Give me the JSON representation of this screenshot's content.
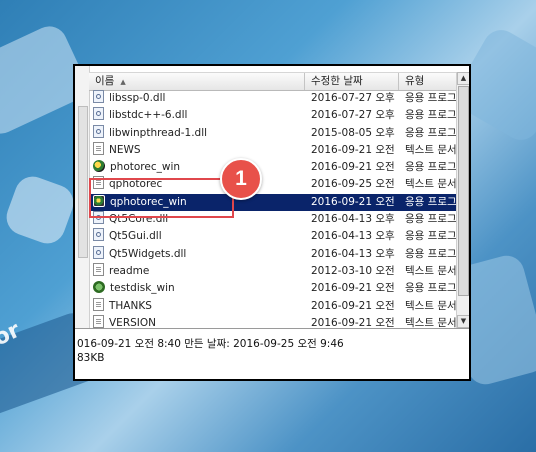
{
  "columns": [
    {
      "label": "이름",
      "sort_icon": "sort-up-icon",
      "sort_glyph": "▲"
    },
    {
      "label": "수정한 날짜"
    },
    {
      "label": "유형"
    }
  ],
  "files": [
    {
      "name": "libssp-0.dll",
      "date": "2016-07-27 오후 ...",
      "type": "응용 프로그",
      "icon": "dll-icon"
    },
    {
      "name": "libstdc++-6.dll",
      "date": "2016-07-27 오후 ...",
      "type": "응용 프로그",
      "icon": "dll-icon"
    },
    {
      "name": "libwinpthread-1.dll",
      "date": "2015-08-05 오후 ...",
      "type": "응용 프로그",
      "icon": "dll-icon"
    },
    {
      "name": "NEWS",
      "date": "2016-09-21 오전 ...",
      "type": "텍스트 문서",
      "icon": "document-icon"
    },
    {
      "name": "photorec_win",
      "date": "2016-09-21 오전 ...",
      "type": "응용 프로그",
      "icon": "photorec-app-icon"
    },
    {
      "name": "qphotorec",
      "date": "2016-09-25 오전 ...",
      "type": "텍스트 문서",
      "icon": "document-icon"
    },
    {
      "name": "qphotorec_win",
      "date": "2016-09-21 오전 ...",
      "type": "응용 프로그",
      "icon": "qphotorec-app-icon",
      "selected": true
    },
    {
      "name": "Qt5Core.dll",
      "date": "2016-04-13 오후 ...",
      "type": "응용 프로그",
      "icon": "dll-icon"
    },
    {
      "name": "Qt5Gui.dll",
      "date": "2016-04-13 오후 ...",
      "type": "응용 프로그",
      "icon": "dll-icon"
    },
    {
      "name": "Qt5Widgets.dll",
      "date": "2016-04-13 오후 ...",
      "type": "응용 프로그",
      "icon": "dll-icon"
    },
    {
      "name": "readme",
      "date": "2012-03-10 오전 ...",
      "type": "텍스트 문서",
      "icon": "document-icon"
    },
    {
      "name": "testdisk_win",
      "date": "2016-09-21 오전 ...",
      "type": "응용 프로그",
      "icon": "testdisk-app-icon"
    },
    {
      "name": "THANKS",
      "date": "2016-09-21 오전 ...",
      "type": "텍스트 문서",
      "icon": "document-icon"
    },
    {
      "name": "VERSION",
      "date": "2016-09-21 오전 ...",
      "type": "텍스트 문서",
      "icon": "document-icon"
    }
  ],
  "status": {
    "line1": "016-09-21 오전 8:40      만든 날짜: 2016-09-25 오전 9:46",
    "line2": "83KB"
  },
  "annotation": {
    "badge": "1"
  },
  "background_text": "or",
  "colors": {
    "selection": "#0a246a",
    "annotation": "#e0474c"
  }
}
